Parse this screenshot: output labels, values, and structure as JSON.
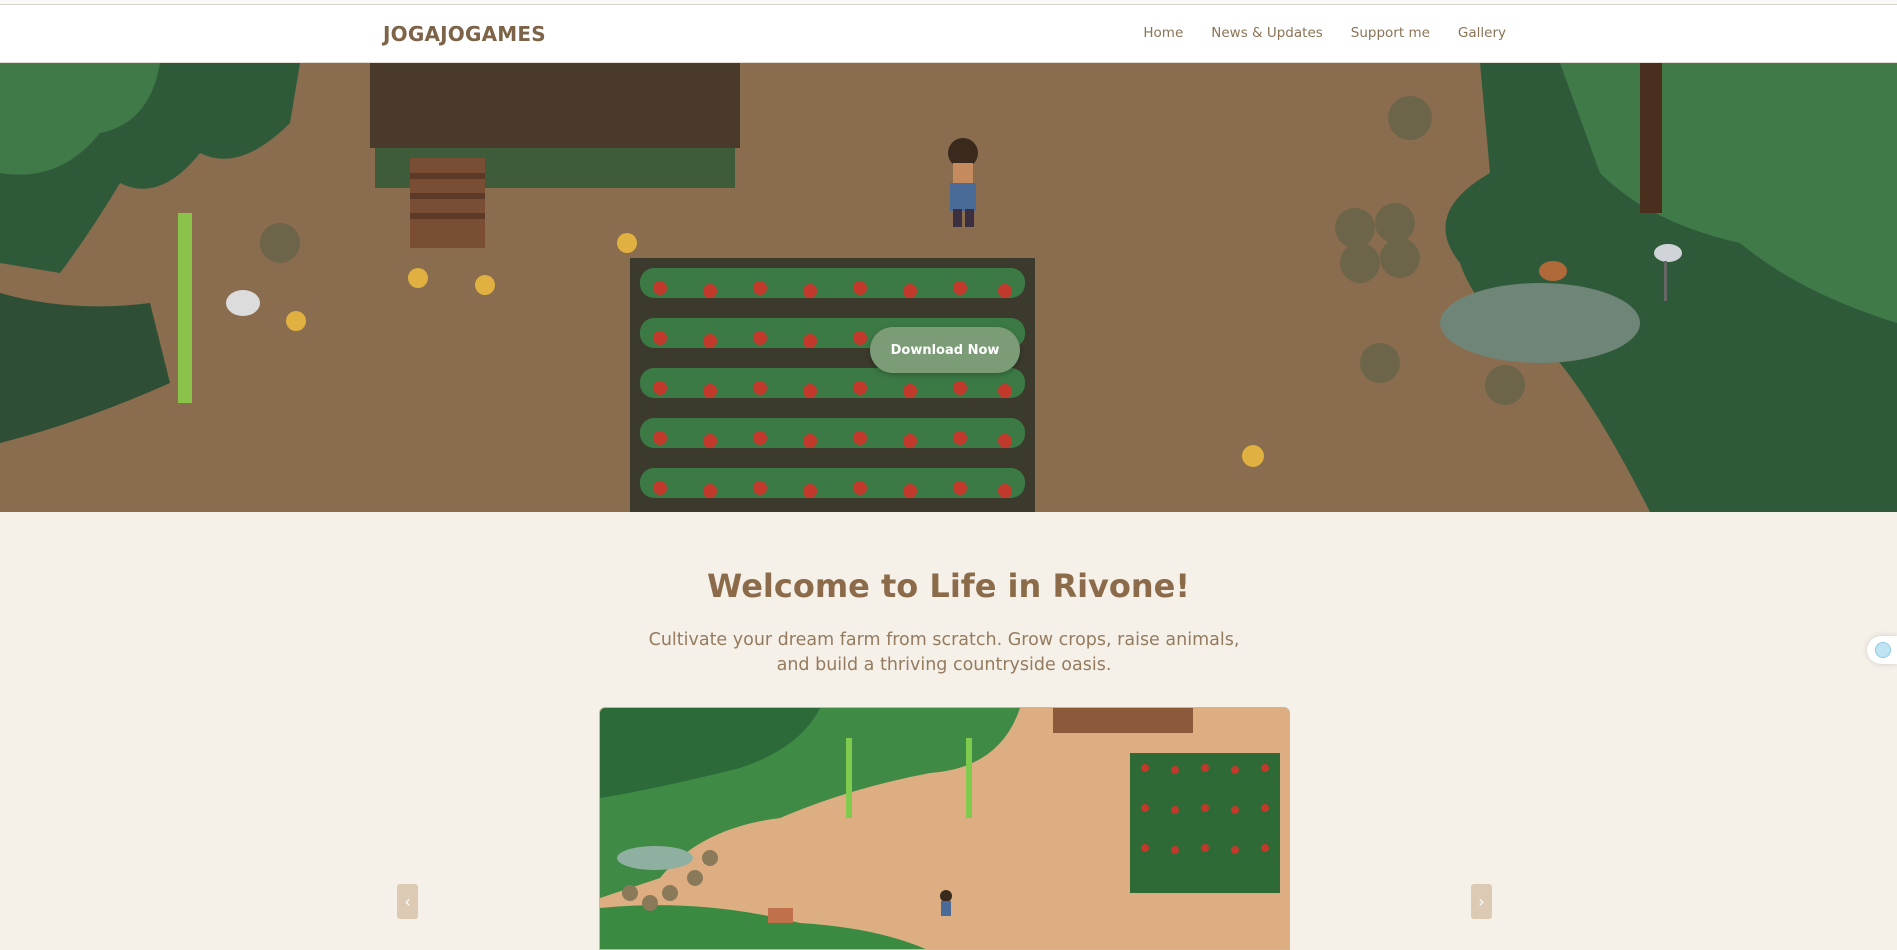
{
  "navbar": {
    "brand": "JOGAJOGAMES",
    "links": [
      "Home",
      "News & Updates",
      "Support me",
      "Gallery"
    ]
  },
  "hero": {
    "image_description": "pixel-art-farm-scene",
    "download_label": "Download Now"
  },
  "intro": {
    "title": "Welcome to Life in Rivone!",
    "subtitle": "Cultivate your dream farm from scratch. Grow crops, raise animals, and build a thriving countryside oasis."
  },
  "carousel": {
    "prev_icon": "chevron-left-icon",
    "next_icon": "chevron-right-icon",
    "prev_glyph": "‹",
    "next_glyph": "›"
  },
  "colors": {
    "page_bg": "#f5f0e8",
    "brand_brown": "#7d6347",
    "button_green": "#7b9c76",
    "dirt": "#8a6c4f",
    "foliage": "#2f5a3a"
  }
}
